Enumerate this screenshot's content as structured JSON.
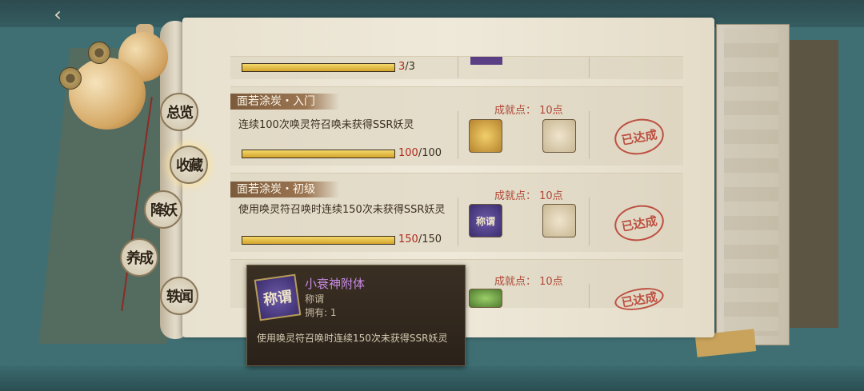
{
  "nav": {
    "back_icon": "‹",
    "items": [
      {
        "label": "总览"
      },
      {
        "label": "收藏"
      },
      {
        "label": "降妖"
      },
      {
        "label": "养成"
      },
      {
        "label": "轶闻"
      }
    ]
  },
  "rows": [
    {
      "progress_cur": "3",
      "progress_total": "/3",
      "progress": 1.0
    },
    {
      "title": "面若涂炭・入门",
      "desc": "连续100次唤灵符召唤未获得SSR妖灵",
      "points": "成就点： 10点",
      "progress_cur": "100",
      "progress_total": "/100",
      "progress": 1.0,
      "stamp": "已达成"
    },
    {
      "title": "面若涂炭・初级",
      "desc": "使用唤灵符召唤时连续150次未获得SSR妖灵",
      "points": "成就点： 10点",
      "progress_cur": "150",
      "progress_total": "/150",
      "progress": 1.0,
      "stamp": "已达成",
      "reward_icon_text": "称谓"
    },
    {
      "title": "",
      "points": "成就点： 10点",
      "stamp": "已达成"
    }
  ],
  "tooltip": {
    "icon_text": "称谓",
    "name": "小衰神附体",
    "type": "称谓",
    "owned": "拥有: 1",
    "desc": "使用唤灵符召唤时连续150次未获得SSR妖灵"
  },
  "colors": {
    "accent": "#b8392b",
    "tooltip_name": "#c78be6",
    "progress_fill": "#e3bd45"
  }
}
